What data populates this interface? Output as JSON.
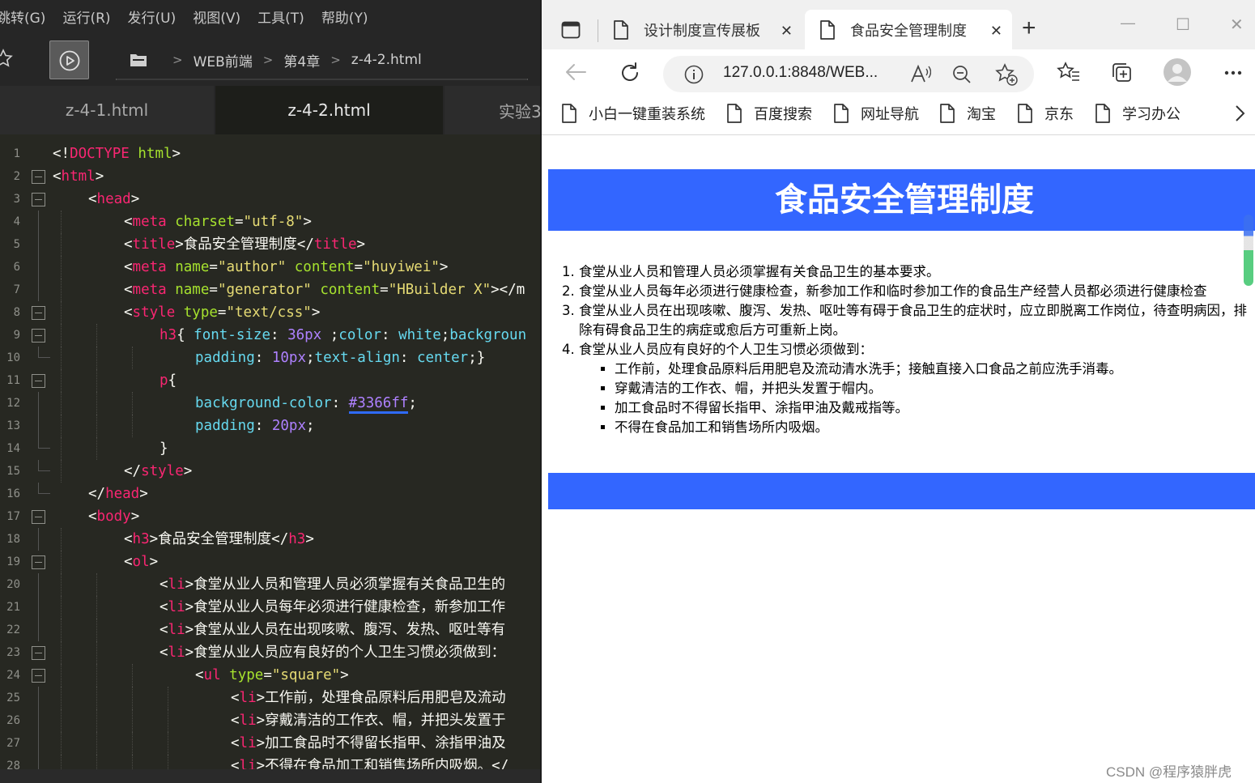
{
  "editor": {
    "menu": [
      "跳转(G)",
      "运行(R)",
      "发行(U)",
      "视图(V)",
      "工具(T)",
      "帮助(Y)"
    ],
    "breadcrumb": [
      "WEB前端",
      "第4章",
      "z-4-2.html"
    ],
    "tabs": [
      "z-4-1.html",
      "z-4-2.html",
      "实验3"
    ],
    "active_tab": "z-4-2.html",
    "line_numbers": [
      "1",
      "2",
      "3",
      "4",
      "5",
      "6",
      "7",
      "8",
      "9",
      "10",
      "11",
      "12",
      "13",
      "14",
      "15",
      "16",
      "17",
      "18",
      "19",
      "20",
      "21",
      "22",
      "23",
      "24",
      "25",
      "26",
      "27",
      "28"
    ],
    "code": {
      "l1": [
        "<!",
        "DOCTYPE",
        " html",
        ">"
      ],
      "l2": [
        "<",
        "html",
        ">"
      ],
      "l3": [
        "<",
        "head",
        ">"
      ],
      "l4": [
        "<",
        "meta",
        " charset",
        "=",
        "\"utf-8\"",
        ">"
      ],
      "l5": [
        "<",
        "title",
        ">",
        "食品安全管理制度",
        "</",
        "title",
        ">"
      ],
      "l6": [
        "<",
        "meta",
        " name",
        "=",
        "\"author\"",
        " content",
        "=",
        "\"huyiwei\"",
        ">"
      ],
      "l7": [
        "<",
        "meta",
        " name",
        "=",
        "\"generator\"",
        " content",
        "=",
        "\"HBuilder X\"",
        "></m"
      ],
      "l8": [
        "<",
        "style",
        " type",
        "=",
        "\"text/css\"",
        ">"
      ],
      "l9": [
        "h3",
        "{ ",
        "font-size",
        ": ",
        "36px",
        " ;",
        "color",
        ": ",
        "white",
        ";",
        "backgroun"
      ],
      "l10": [
        "padding",
        ": ",
        "10px",
        ";",
        "text-align",
        ": ",
        "center",
        ";}"
      ],
      "l11": [
        "p",
        "{"
      ],
      "l12": [
        "background-color",
        ": ",
        "#3366ff",
        ";"
      ],
      "l13": [
        "padding",
        ": ",
        "20px",
        ";"
      ],
      "l14": [
        "}"
      ],
      "l15": [
        "</",
        "style",
        ">"
      ],
      "l16": [
        "</",
        "head",
        ">"
      ],
      "l17": [
        "<",
        "body",
        ">"
      ],
      "l18": [
        "<",
        "h3",
        ">",
        "食品安全管理制度",
        "</",
        "h3",
        ">"
      ],
      "l19": [
        "<",
        "ol",
        ">"
      ],
      "l20": [
        "<",
        "li",
        ">",
        "食堂从业人员和管理人员必须掌握有关食品卫生的"
      ],
      "l21": [
        "<",
        "li",
        ">",
        "食堂从业人员每年必须进行健康检查，新参加工作"
      ],
      "l22": [
        "<",
        "li",
        ">",
        "食堂从业人员在出现咳嗽、腹泻、发热、呕吐等有"
      ],
      "l23": [
        "<",
        "li",
        ">",
        "食堂从业人员应有良好的个人卫生习惯必须做到："
      ],
      "l24": [
        "<",
        "ul",
        " type",
        "=",
        "\"square\"",
        ">"
      ],
      "l25": [
        "<",
        "li",
        ">",
        "工作前，处理食品原料后用肥皂及流动"
      ],
      "l26": [
        "<",
        "li",
        ">",
        "穿戴清洁的工作衣、帽，并把头发置于"
      ],
      "l27": [
        "<",
        "li",
        ">",
        "加工食品时不得留长指甲、涂指甲油及"
      ],
      "l28": [
        "<",
        "li",
        ">",
        "不得在食品加工和销售场所内吸烟。</"
      ]
    }
  },
  "browser": {
    "tabs": [
      "设计制度宣传展板",
      "食品安全管理制度"
    ],
    "active_tab": "食品安全管理制度",
    "close_glyph": "✕",
    "new_tab_glyph": "+",
    "window_controls": [
      "—",
      "☐",
      "✕"
    ],
    "url": "127.0.0.1:8848/WEB...",
    "favorites": [
      "小白一键重装系统",
      "百度搜索",
      "网址导航",
      "淘宝",
      "京东",
      "学习办公"
    ],
    "page": {
      "h3": "食品安全管理制度",
      "ol": [
        "食堂从业人员和管理人员必须掌握有关食品卫生的基本要求。",
        "食堂从业人员每年必须进行健康检查，新参加工作和临时参加工作的食品生产经营人员都必须进行健康检查",
        "食堂从业人员在出现咳嗽、腹泻、发热、呕吐等有碍于食品卫生的症状时，应立即脱离工作岗位，待查明病因，排除有碍食品卫生的病症或愈后方可重新上岗。",
        "食堂从业人员应有良好的个人卫生习惯必须做到："
      ],
      "ul": [
        "工作前，处理食品原料后用肥皂及流动清水洗手；接触直接入口食品之前应洗手消毒。",
        "穿戴清洁的工作衣、帽，并把头发置于帽内。",
        "加工食品时不得留长指甲、涂指甲油及戴戒指等。",
        "不得在食品加工和销售场所内吸烟。"
      ]
    }
  },
  "watermark": "CSDN @程序猿胖虎",
  "colors": {
    "editor_bg": "#272822",
    "tag": "#f92672",
    "attr": "#a6e22e",
    "string": "#e6db74",
    "property": "#66d9ef",
    "number": "#ae81ff",
    "page_accent": "#3366ff"
  },
  "icons": [
    "star-icon",
    "run-icon",
    "folder-icon",
    "chevron-right-icon",
    "sidebar-toggle-icon",
    "document-icon",
    "back-arrow-icon",
    "refresh-icon",
    "info-icon",
    "read-aloud-icon",
    "zoom-out-icon",
    "add-favorite-icon",
    "favorites-icon",
    "collections-icon",
    "profile-icon",
    "more-icon"
  ]
}
